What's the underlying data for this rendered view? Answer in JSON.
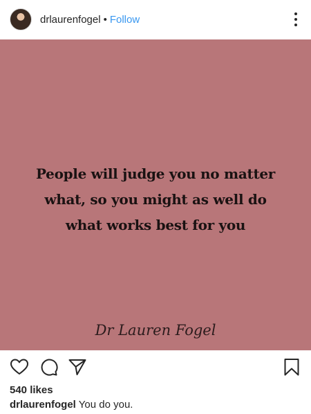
{
  "header": {
    "username": "drlaurenfogel",
    "separator": "•",
    "follow_label": "Follow"
  },
  "post": {
    "background_color": "#b87679",
    "quote": "People will judge you no matter what, so you might as well do what works best for you",
    "signature": "Dr Lauren Fogel"
  },
  "actions": {
    "icons": [
      "heart-icon",
      "comment-icon",
      "share-icon",
      "bookmark-icon"
    ]
  },
  "likes": "540 likes",
  "caption": {
    "username": "drlaurenfogel",
    "text": "You do you."
  },
  "colors": {
    "link": "#3897f0",
    "text": "#262626"
  }
}
